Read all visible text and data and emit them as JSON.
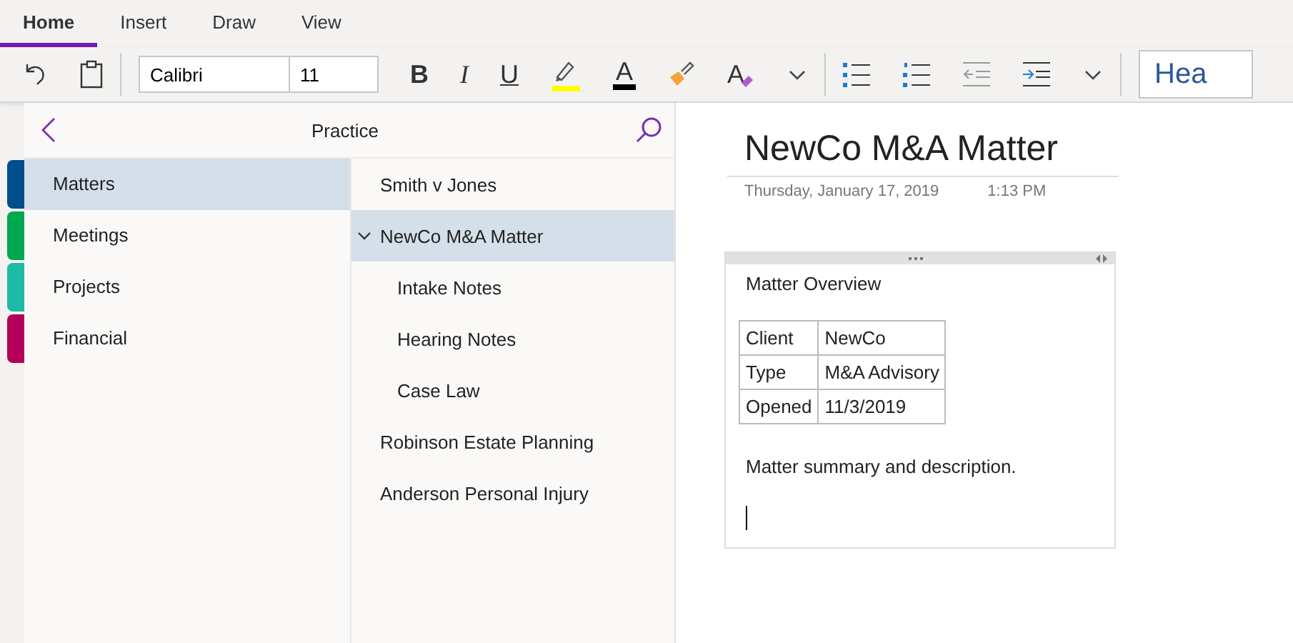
{
  "ribbon": {
    "tabs": [
      {
        "label": "Home",
        "selected": true
      },
      {
        "label": "Insert",
        "selected": false
      },
      {
        "label": "Draw",
        "selected": false
      },
      {
        "label": "View",
        "selected": false
      }
    ],
    "toolbar": {
      "font": "Calibri",
      "size": "11",
      "bold": "B",
      "italic": "I",
      "underline": "U",
      "font_color_letter": "A",
      "clear_format_letter": "A",
      "style": "Hea"
    }
  },
  "notebook": {
    "title": "Practice"
  },
  "sections": [
    {
      "label": "Matters",
      "selected": true,
      "color": "#004e8c"
    },
    {
      "label": "Meetings",
      "selected": false,
      "color": "#00a84f"
    },
    {
      "label": "Projects",
      "selected": false,
      "color": "#1ebaa8"
    },
    {
      "label": "Financial",
      "selected": false,
      "color": "#b4005a"
    }
  ],
  "pages": [
    {
      "label": "Smith v Jones",
      "selected": false
    },
    {
      "label": "NewCo M&A Matter",
      "selected": true,
      "expanded": true,
      "children": [
        {
          "label": "Intake  Notes",
          "selected": false
        },
        {
          "label": "Hearing Notes",
          "selected": false
        },
        {
          "label": "Case Law",
          "selected": false
        }
      ]
    },
    {
      "label": "Robinson Estate Planning",
      "selected": false
    },
    {
      "label": "Anderson Personal Injury",
      "selected": false
    }
  ],
  "page": {
    "title": "NewCo M&A Matter",
    "date": "Thursday, January 17, 2019",
    "time": "1:13 PM",
    "note": {
      "heading": "Matter Overview",
      "table": [
        [
          "Client",
          "NewCo"
        ],
        [
          "Type",
          "M&A Advisory"
        ],
        [
          "Opened",
          "11/3/2019"
        ]
      ],
      "text": "Matter summary and description."
    }
  }
}
